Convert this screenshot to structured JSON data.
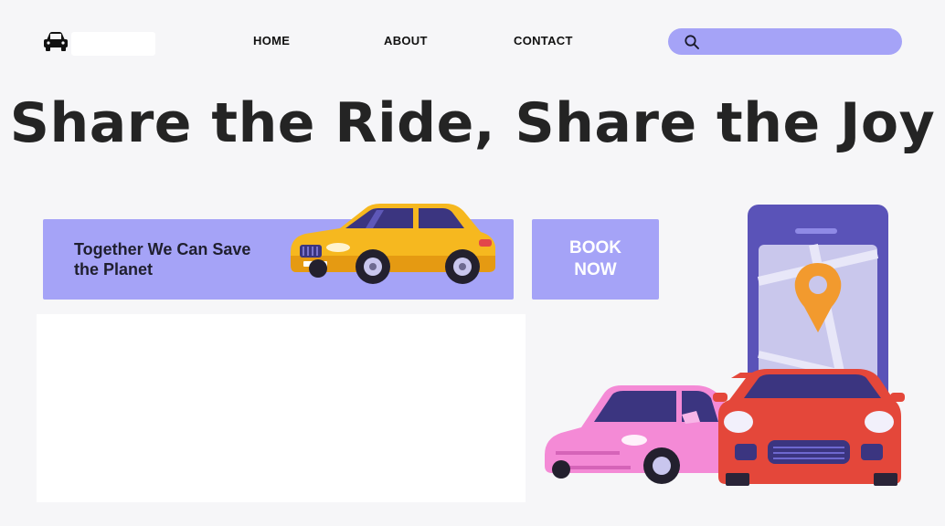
{
  "header": {
    "nav": {
      "home": "HOME",
      "about": "ABOUT",
      "contact": "CONTACT"
    },
    "search": {
      "placeholder": "",
      "value": ""
    }
  },
  "hero": {
    "title": "Share the Ride, Share the Joy"
  },
  "promo": {
    "text": "Together We Can Save the Planet"
  },
  "cta": {
    "book_label": "BOOK NOW"
  },
  "icons": {
    "logo": "car-icon",
    "search": "search-icon",
    "map_pin": "location-pin-icon"
  },
  "colors": {
    "accent": "#a5a3f7",
    "background": "#f6f6f8",
    "title": "#242424",
    "yellow_car": "#f6b81f",
    "pink_car": "#f48ad6",
    "red_car": "#e4473a",
    "phone": "#5a53b8",
    "pin": "#f29a2e"
  }
}
